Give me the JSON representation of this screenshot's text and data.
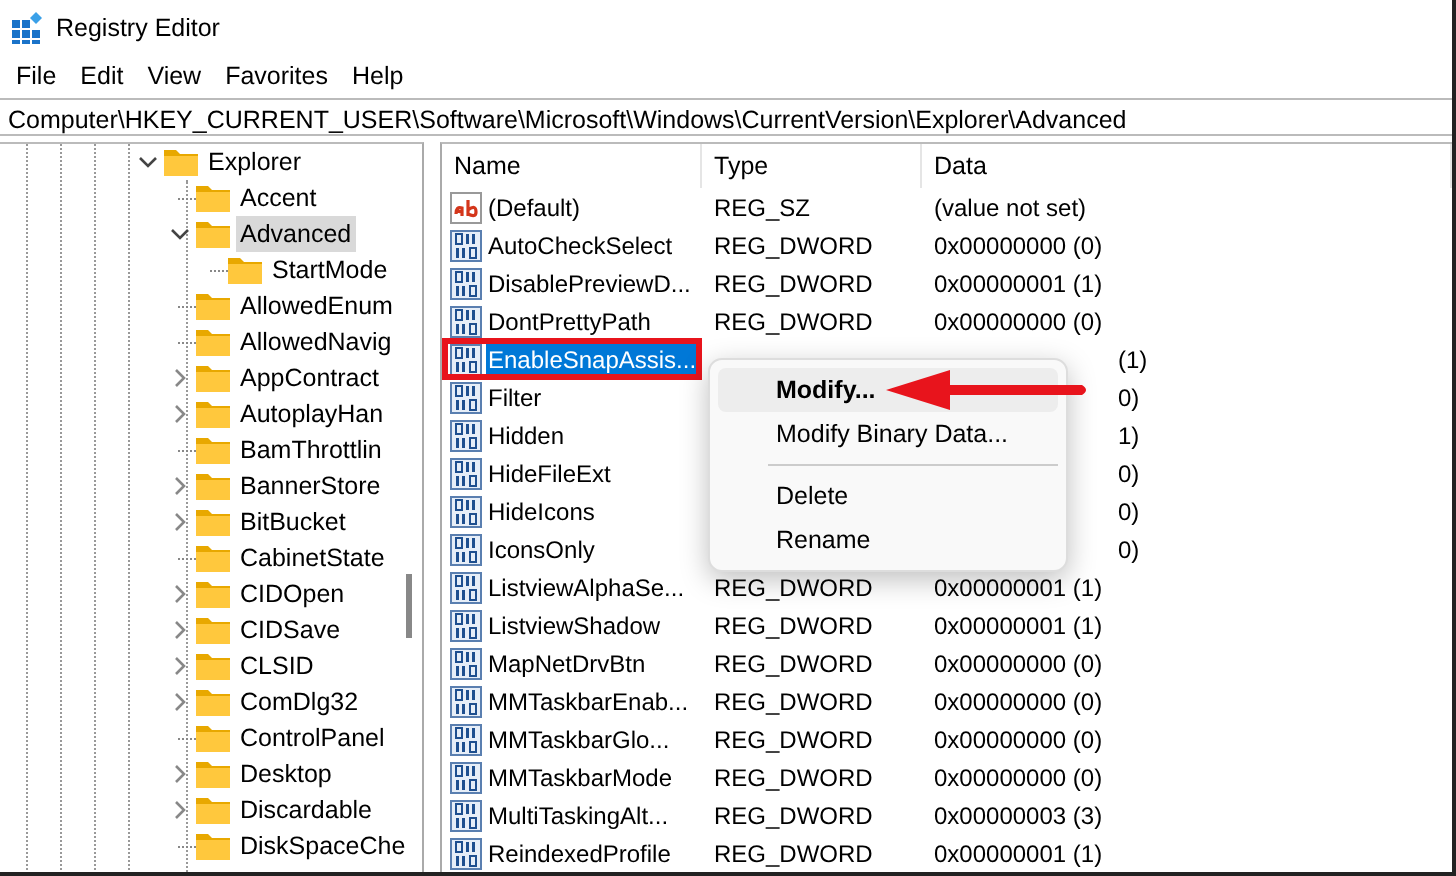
{
  "window": {
    "title": "Registry Editor"
  },
  "menu_bar": [
    "File",
    "Edit",
    "View",
    "Favorites",
    "Help"
  ],
  "address_bar": "Computer\\HKEY_CURRENT_USER\\Software\\Microsoft\\Windows\\CurrentVersion\\Explorer\\Advanced",
  "tree": [
    {
      "label": "Explorer",
      "expanded": true,
      "selected": false,
      "children": [
        {
          "label": "Accent",
          "selected": false
        },
        {
          "label": "Advanced",
          "expanded": true,
          "selected": true,
          "children": [
            {
              "label": "StartMode",
              "selected": false
            }
          ]
        },
        {
          "label": "AllowedEnum",
          "selected": false
        },
        {
          "label": "AllowedNavig",
          "selected": false
        },
        {
          "label": "AppContract",
          "expanded": false,
          "selected": false
        },
        {
          "label": "AutoplayHan",
          "expanded": false,
          "selected": false
        },
        {
          "label": "BamThrottlin",
          "selected": false
        },
        {
          "label": "BannerStore",
          "expanded": false,
          "selected": false
        },
        {
          "label": "BitBucket",
          "expanded": false,
          "selected": false
        },
        {
          "label": "CabinetState",
          "selected": false
        },
        {
          "label": "CIDOpen",
          "expanded": false,
          "selected": false
        },
        {
          "label": "CIDSave",
          "expanded": false,
          "selected": false
        },
        {
          "label": "CLSID",
          "expanded": false,
          "selected": false
        },
        {
          "label": "ComDlg32",
          "expanded": false,
          "selected": false
        },
        {
          "label": "ControlPanel",
          "selected": false
        },
        {
          "label": "Desktop",
          "expanded": false,
          "selected": false
        },
        {
          "label": "Discardable",
          "expanded": false,
          "selected": false
        },
        {
          "label": "DiskSpaceChe",
          "selected": false
        }
      ]
    }
  ],
  "table": {
    "columns": [
      "Name",
      "Type",
      "Data"
    ],
    "rows": [
      {
        "kind": "string",
        "name": "(Default)",
        "type": "REG_SZ",
        "data": "(value not set)",
        "selected": false,
        "boxed": false
      },
      {
        "kind": "dword",
        "name": "AutoCheckSelect",
        "type": "REG_DWORD",
        "data": "0x00000000 (0)",
        "selected": false,
        "boxed": false
      },
      {
        "kind": "dword",
        "name": "DisablePreviewD...",
        "type": "REG_DWORD",
        "data": "0x00000001 (1)",
        "selected": false,
        "boxed": false
      },
      {
        "kind": "dword",
        "name": "DontPrettyPath",
        "type": "REG_DWORD",
        "data": "0x00000000 (0)",
        "selected": false,
        "boxed": false
      },
      {
        "kind": "dword",
        "name": "EnableSnapAssis...",
        "data": "(1)",
        "selected": true,
        "boxed": true
      },
      {
        "kind": "dword",
        "name": "Filter",
        "data": "0)",
        "selected": false,
        "boxed": false
      },
      {
        "kind": "dword",
        "name": "Hidden",
        "data": "1)",
        "selected": false,
        "boxed": false
      },
      {
        "kind": "dword",
        "name": "HideFileExt",
        "data": "0)",
        "selected": false,
        "boxed": false
      },
      {
        "kind": "dword",
        "name": "HideIcons",
        "data": "0)",
        "selected": false,
        "boxed": false
      },
      {
        "kind": "dword",
        "name": "IconsOnly",
        "data": "0)",
        "selected": false,
        "boxed": false
      },
      {
        "kind": "dword",
        "name": "ListviewAlphaSe...",
        "type": "REG_DWORD",
        "data": "0x00000001 (1)",
        "selected": false,
        "boxed": false
      },
      {
        "kind": "dword",
        "name": "ListviewShadow",
        "type": "REG_DWORD",
        "data": "0x00000001 (1)",
        "selected": false,
        "boxed": false
      },
      {
        "kind": "dword",
        "name": "MapNetDrvBtn",
        "type": "REG_DWORD",
        "data": "0x00000000 (0)",
        "selected": false,
        "boxed": false
      },
      {
        "kind": "dword",
        "name": "MMTaskbarEnab...",
        "type": "REG_DWORD",
        "data": "0x00000000 (0)",
        "selected": false,
        "boxed": false
      },
      {
        "kind": "dword",
        "name": "MMTaskbarGlo...",
        "type": "REG_DWORD",
        "data": "0x00000000 (0)",
        "selected": false,
        "boxed": false
      },
      {
        "kind": "dword",
        "name": "MMTaskbarMode",
        "type": "REG_DWORD",
        "data": "0x00000000 (0)",
        "selected": false,
        "boxed": false
      },
      {
        "kind": "dword",
        "name": "MultiTaskingAlt...",
        "type": "REG_DWORD",
        "data": "0x00000003 (3)",
        "selected": false,
        "boxed": false
      },
      {
        "kind": "dword",
        "name": "ReindexedProfile",
        "type": "REG_DWORD",
        "data": "0x00000001 (1)",
        "selected": false,
        "boxed": false
      }
    ]
  },
  "context_menu": [
    {
      "kind": "item",
      "label": "Modify...",
      "default": true,
      "hovered": true,
      "arrow": true
    },
    {
      "kind": "item",
      "label": "Modify Binary Data...",
      "default": false,
      "hovered": false,
      "arrow": false
    },
    {
      "kind": "separator"
    },
    {
      "kind": "item",
      "label": "Delete",
      "default": false,
      "hovered": false,
      "arrow": false
    },
    {
      "kind": "item",
      "label": "Rename",
      "default": false,
      "hovered": false,
      "arrow": false
    }
  ]
}
